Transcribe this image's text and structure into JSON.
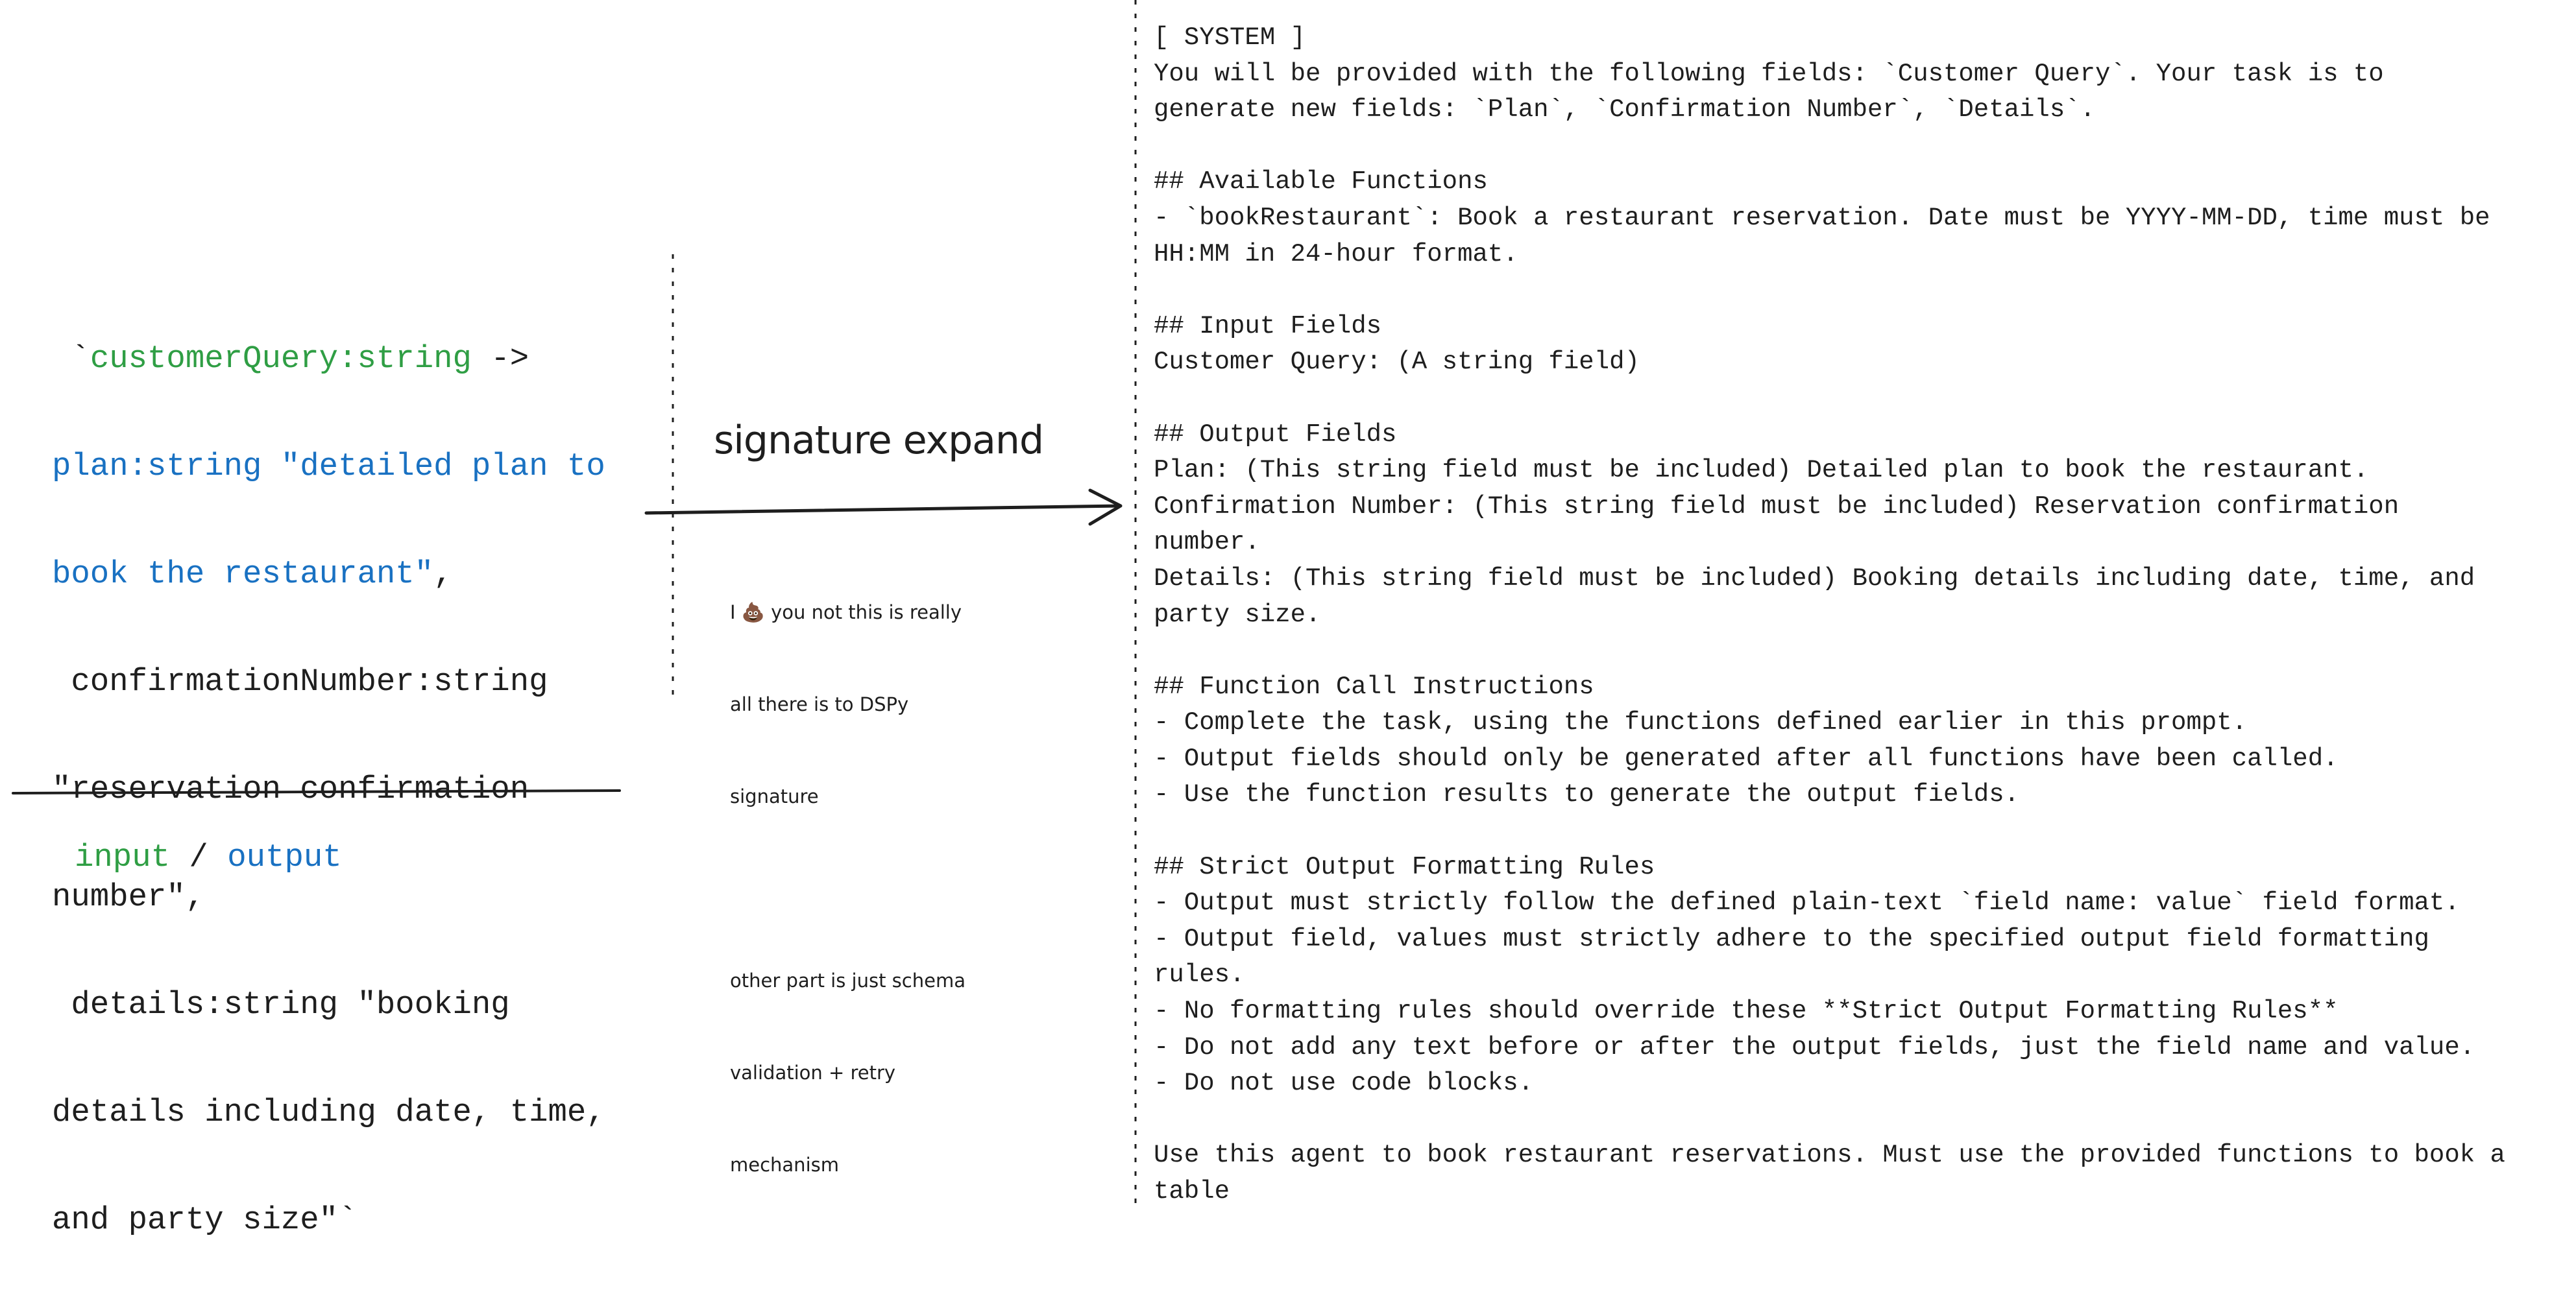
{
  "colors": {
    "input": "#2f9e44",
    "output": "#1971c2",
    "text": "#1e1e1e"
  },
  "signature": {
    "l0": {
      "a": " `",
      "b": "customerQuery:string",
      "c": " ->"
    },
    "l1": "plan:string \"detailed plan to",
    "l2": {
      "a": "book the restaurant\"",
      "b": ","
    },
    "l3": " confirmationNumber:string",
    "l4": "\"reservation confirmation",
    "l5": "number\",",
    "l6": " details:string \"booking",
    "l7": "details including date, time,",
    "l8": "and party size\"`"
  },
  "legend": {
    "input": "input",
    "sep": " / ",
    "output": "output"
  },
  "arrow_label": "signature expand",
  "note": [
    "I 💩 you not this is really",
    "all there is to DSPy",
    "signature",
    "",
    "other part is just schema",
    "validation + retry",
    "mechanism"
  ],
  "prompt_lines": [
    "[ SYSTEM ]",
    "You will be provided with the following fields: `Customer Query`. Your task is to",
    "generate new fields: `Plan`, `Confirmation Number`, `Details`.",
    "",
    "## Available Functions",
    "- `bookRestaurant`: Book a restaurant reservation. Date must be YYYY-MM-DD, time must be",
    "HH:MM in 24-hour format.",
    "",
    "## Input Fields",
    "Customer Query: (A string field)",
    "",
    "## Output Fields",
    "Plan: (This string field must be included) Detailed plan to book the restaurant.",
    "Confirmation Number: (This string field must be included) Reservation confirmation",
    "number.",
    "Details: (This string field must be included) Booking details including date, time, and",
    "party size.",
    "",
    "## Function Call Instructions",
    "- Complete the task, using the functions defined earlier in this prompt.",
    "- Output fields should only be generated after all functions have been called.",
    "- Use the function results to generate the output fields.",
    "",
    "## Strict Output Formatting Rules",
    "- Output must strictly follow the defined plain-text `field name: value` field format.",
    "- Output field, values must strictly adhere to the specified output field formatting",
    "rules.",
    "- No formatting rules should override these **Strict Output Formatting Rules**",
    "- Do not add any text before or after the output fields, just the field name and value.",
    "- Do not use code blocks.",
    "",
    "Use this agent to book restaurant reservations. Must use the provided functions to book a",
    "table"
  ]
}
